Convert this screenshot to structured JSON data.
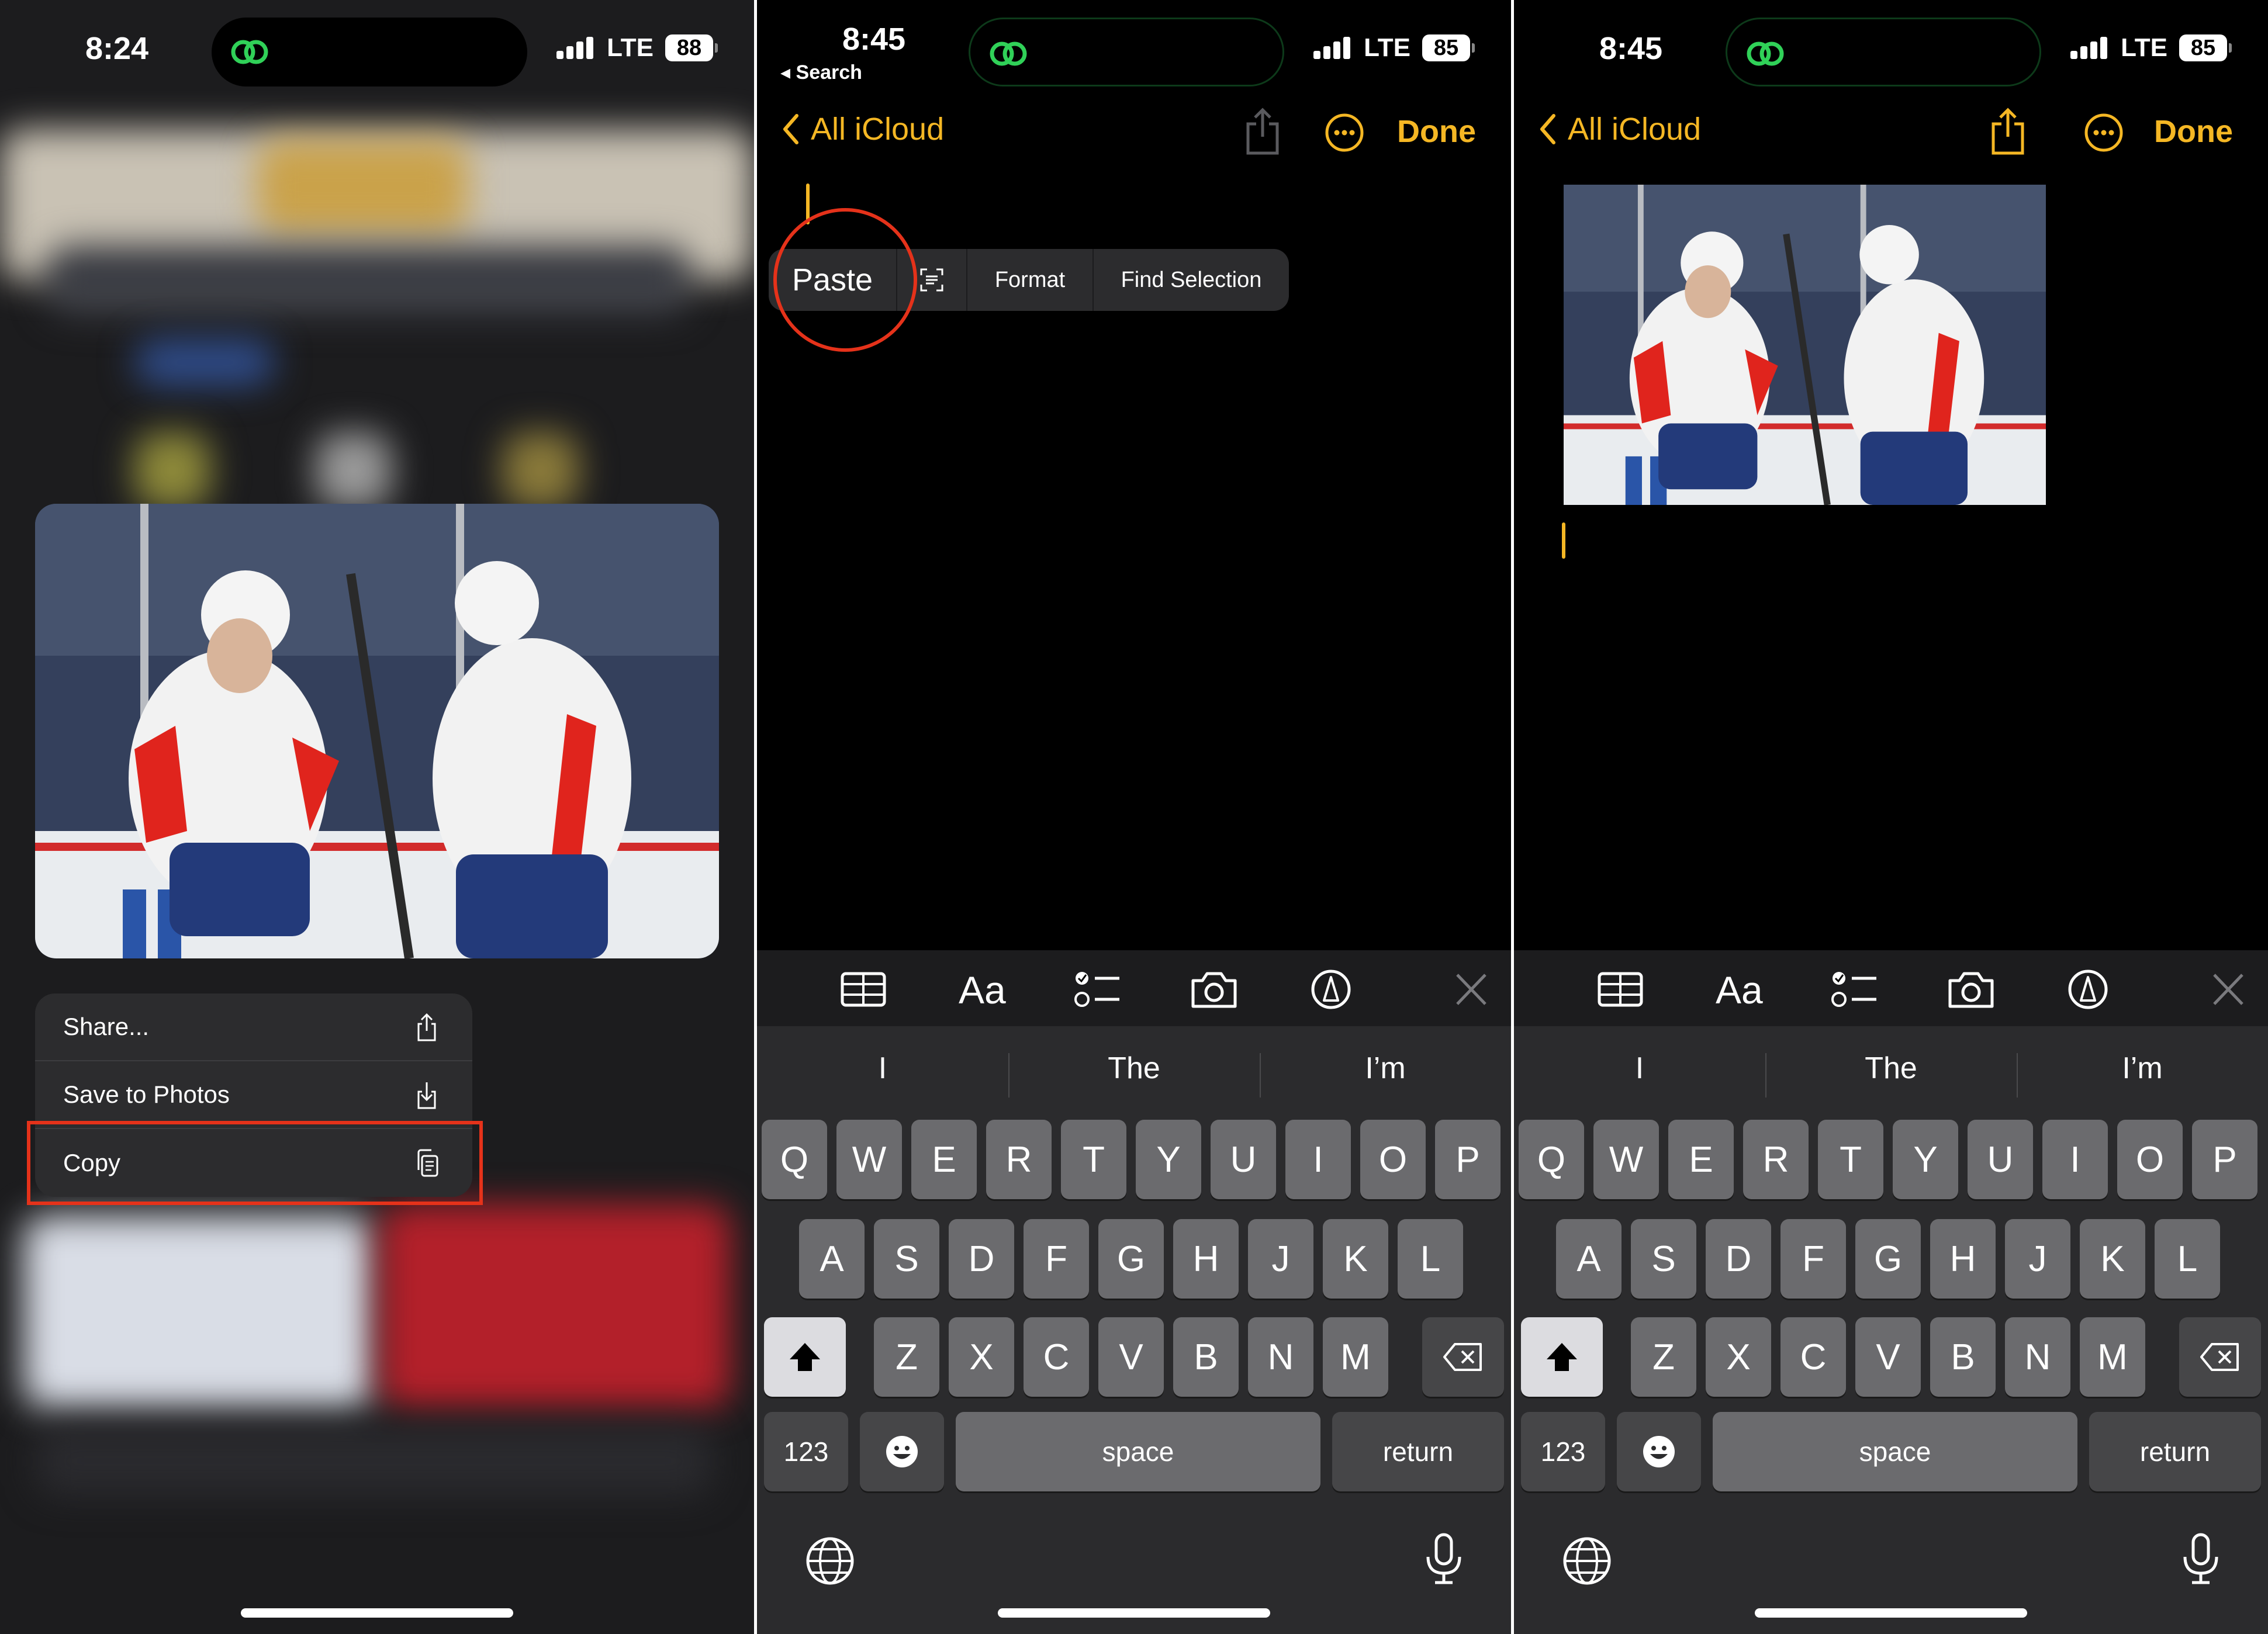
{
  "panel1": {
    "status": {
      "time": "8:24",
      "network": "LTE",
      "battery": "88"
    },
    "context_menu": [
      {
        "label": "Share...",
        "icon": "share-icon"
      },
      {
        "label": "Save to Photos",
        "icon": "save-photo-icon"
      },
      {
        "label": "Copy",
        "icon": "copy-icon"
      }
    ],
    "highlight_color": "#e5321a"
  },
  "panel2": {
    "status": {
      "time": "8:45",
      "back_app": "Search",
      "network": "LTE",
      "battery": "85"
    },
    "nav": {
      "back_label": "All iCloud",
      "done_label": "Done"
    },
    "edit_menu": {
      "paste": "Paste",
      "format": "Format",
      "find_selection": "Find Selection"
    }
  },
  "panel3": {
    "status": {
      "time": "8:45",
      "network": "LTE",
      "battery": "85"
    },
    "nav": {
      "back_label": "All iCloud",
      "done_label": "Done"
    }
  },
  "toolbar": {
    "format_label": "Aa"
  },
  "keyboard": {
    "suggestions": [
      "I",
      "The",
      "I’m"
    ],
    "row1": [
      "Q",
      "W",
      "E",
      "R",
      "T",
      "Y",
      "U",
      "I",
      "O",
      "P"
    ],
    "row2": [
      "A",
      "S",
      "D",
      "F",
      "G",
      "H",
      "J",
      "K",
      "L"
    ],
    "row3": [
      "Z",
      "X",
      "C",
      "V",
      "B",
      "N",
      "M"
    ],
    "numbers_key": "123",
    "space_key": "space",
    "return_key": "return"
  },
  "colors": {
    "accent": "#f5b724",
    "annotation": "#e5321a",
    "island_icon": "#30d158"
  }
}
